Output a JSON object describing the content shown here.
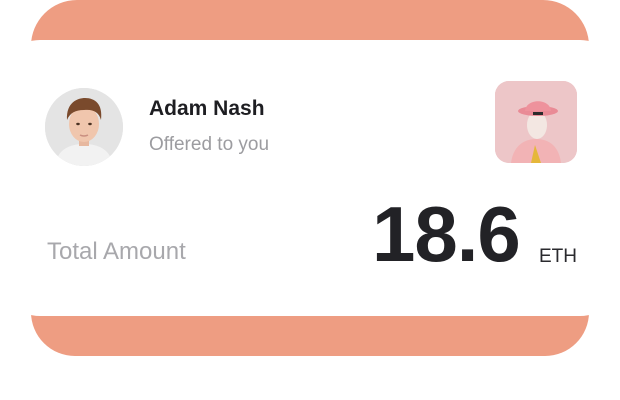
{
  "offer": {
    "user_name": "Adam Nash",
    "subtitle": "Offered to you",
    "total_label": "Total Amount",
    "amount": "18.6",
    "currency": "ETH"
  },
  "colors": {
    "accent_band": "#ee9d82",
    "card_background": "#ffffff",
    "primary_text": "#1e1e22",
    "secondary_text": "#9c9ca0"
  },
  "icons": {
    "avatar": "user-avatar-photo",
    "nft": "nft-artwork-thumbnail"
  }
}
